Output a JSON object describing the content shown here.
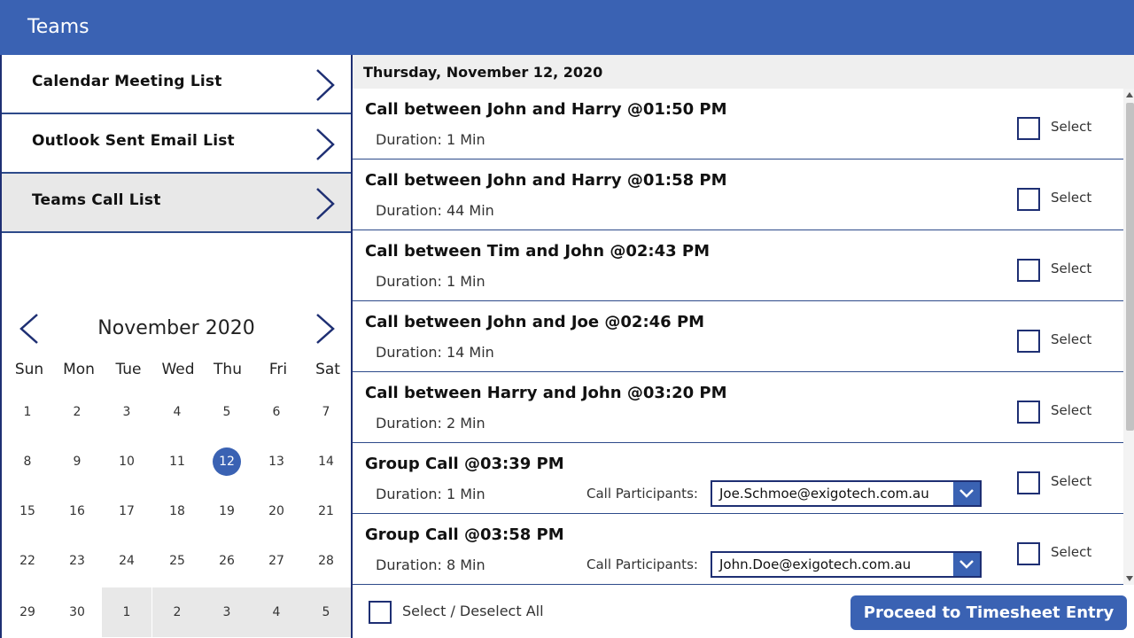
{
  "header": {
    "title": "Teams"
  },
  "sidebar": {
    "items": [
      {
        "label": "Calendar Meeting List"
      },
      {
        "label": "Outlook Sent Email List"
      },
      {
        "label": "Teams Call List"
      }
    ]
  },
  "calendar": {
    "month_label": "November 2020",
    "weekdays": [
      "Sun",
      "Mon",
      "Tue",
      "Wed",
      "Thu",
      "Fri",
      "Sat"
    ],
    "weeks": [
      [
        "1",
        "2",
        "3",
        "4",
        "5",
        "6",
        "7"
      ],
      [
        "8",
        "9",
        "10",
        "11",
        "12",
        "13",
        "14"
      ],
      [
        "15",
        "16",
        "17",
        "18",
        "19",
        "20",
        "21"
      ],
      [
        "22",
        "23",
        "24",
        "25",
        "26",
        "27",
        "28"
      ],
      [
        "29",
        "30",
        "1",
        "2",
        "3",
        "4",
        "5"
      ]
    ],
    "selected_day": "12"
  },
  "main": {
    "date_header": "Thursday, November 12, 2020",
    "calls": [
      {
        "title": "Call between John and Harry @01:50 PM",
        "duration": "Duration: 1 Min",
        "select_label": "Select"
      },
      {
        "title": "Call between John and Harry @01:58 PM",
        "duration": "Duration: 44 Min",
        "select_label": "Select"
      },
      {
        "title": "Call between Tim and John @02:43 PM",
        "duration": "Duration: 1 Min",
        "select_label": "Select"
      },
      {
        "title": "Call between John and Joe @02:46 PM",
        "duration": "Duration: 14 Min",
        "select_label": "Select"
      },
      {
        "title": "Call between Harry and John @03:20 PM",
        "duration": "Duration: 2 Min",
        "select_label": "Select"
      },
      {
        "title": "Group Call @03:39 PM",
        "duration": "Duration: 1 Min",
        "select_label": "Select",
        "participants_label": "Call Participants:",
        "participant": "Joe.Schmoe@exigotech.com.au"
      },
      {
        "title": "Group Call @03:58 PM",
        "duration": "Duration: 8 Min",
        "select_label": "Select",
        "participants_label": "Call Participants:",
        "participant": "John.Doe@exigotech.com.au"
      }
    ],
    "select_all_label": "Select / Deselect All",
    "proceed_label": "Proceed to Timesheet Entry"
  },
  "colors": {
    "brand": "#3a62b3",
    "border": "#1e2f73",
    "highlight": "#e8e8e8"
  }
}
